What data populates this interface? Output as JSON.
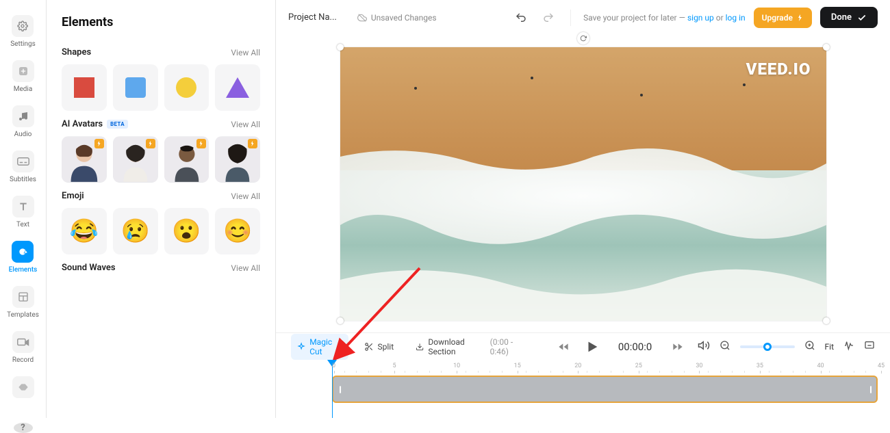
{
  "rail": {
    "items": [
      {
        "label": "Settings"
      },
      {
        "label": "Media"
      },
      {
        "label": "Audio"
      },
      {
        "label": "Subtitles"
      },
      {
        "label": "Text"
      },
      {
        "label": "Elements"
      },
      {
        "label": "Templates"
      },
      {
        "label": "Record"
      }
    ]
  },
  "panel": {
    "title": "Elements",
    "sections": {
      "shapes": {
        "title": "Shapes",
        "view_all": "View All"
      },
      "avatars": {
        "title": "AI Avatars",
        "badge": "BETA",
        "view_all": "View All"
      },
      "emoji": {
        "title": "Emoji",
        "view_all": "View All"
      },
      "soundwaves": {
        "title": "Sound Waves",
        "view_all": "View All"
      }
    }
  },
  "topbar": {
    "project_name": "Project Na...",
    "unsaved": "Unsaved Changes",
    "save_prompt_pre": "Save your project for later — ",
    "signup": "sign up",
    "or": " or ",
    "login": "log in",
    "upgrade": "Upgrade",
    "done": "Done"
  },
  "preview": {
    "watermark": "VEED.IO"
  },
  "controls": {
    "magic_cut": "Magic Cut",
    "split": "Split",
    "download_section": "Download Section",
    "download_range": "(0:00 - 0:46)",
    "timecode": "00:00:0",
    "fit": "Fit"
  },
  "ruler": {
    "marks": [
      "0",
      "5",
      "10",
      "15",
      "20",
      "25",
      "30",
      "35",
      "40",
      "45"
    ]
  }
}
